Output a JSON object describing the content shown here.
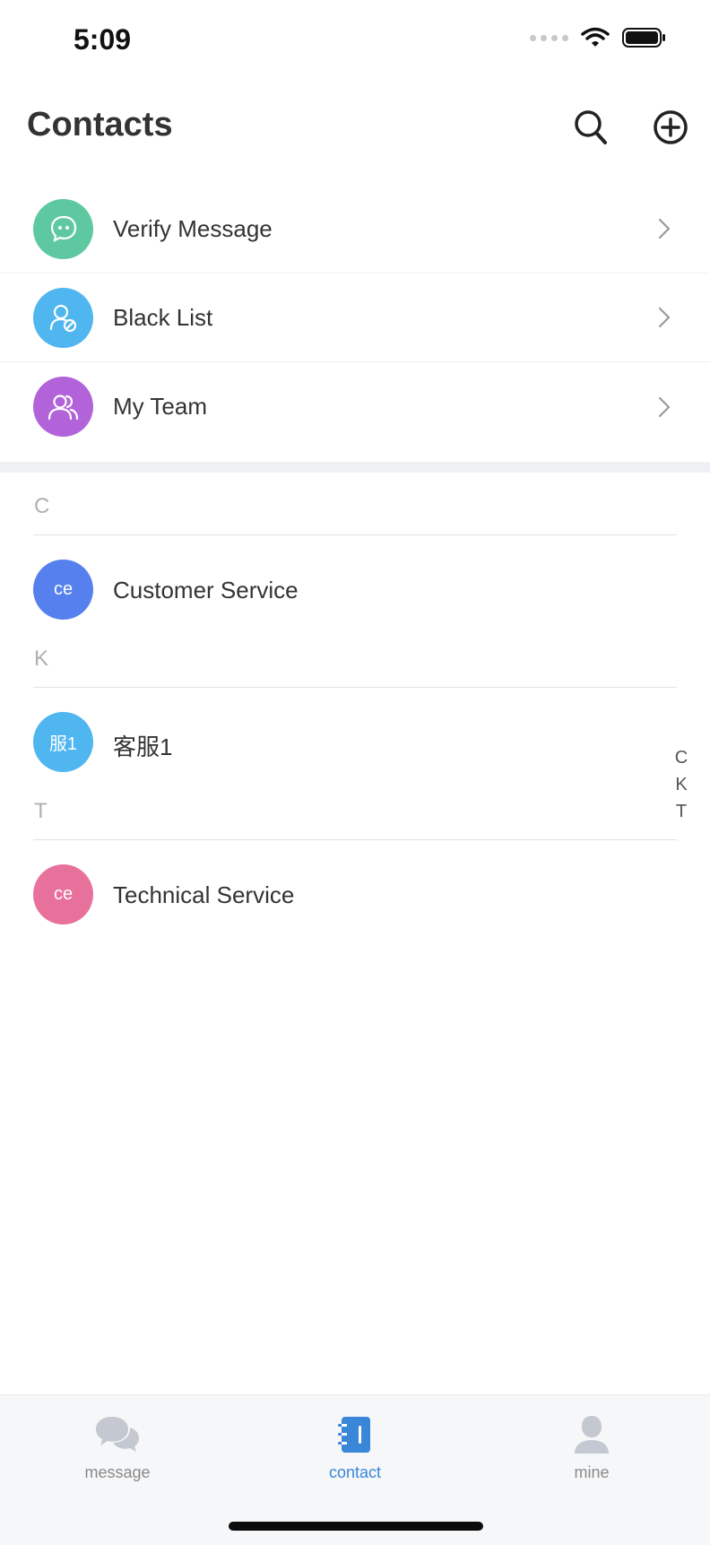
{
  "status_bar": {
    "time": "5:09"
  },
  "header": {
    "title": "Contacts"
  },
  "functions": [
    {
      "label": "Verify Message",
      "icon": "message-dots-icon",
      "color": "#5ec9a0"
    },
    {
      "label": "Black List",
      "icon": "blocked-user-icon",
      "color": "#4fb6f0"
    },
    {
      "label": "My Team",
      "icon": "team-icon",
      "color": "#b263d9"
    }
  ],
  "contact_groups": [
    {
      "letter": "C",
      "contacts": [
        {
          "avatar_text": "ce",
          "name": "Customer Service",
          "color": "#5580ee"
        }
      ]
    },
    {
      "letter": "K",
      "contacts": [
        {
          "avatar_text": "服1",
          "name": "客服1",
          "color": "#4fb6f0"
        }
      ]
    },
    {
      "letter": "T",
      "contacts": [
        {
          "avatar_text": "ce",
          "name": "Technical Service",
          "color": "#e8719b"
        }
      ]
    }
  ],
  "index_letters": [
    "C",
    "K",
    "T"
  ],
  "tabs": [
    {
      "label": "message",
      "icon": "chat-bubbles-icon",
      "active": false
    },
    {
      "label": "contact",
      "icon": "contact-book-icon",
      "active": true
    },
    {
      "label": "mine",
      "icon": "user-profile-icon",
      "active": false
    }
  ],
  "colors": {
    "accent": "#3a86d8",
    "inactive": "#c4c8d0"
  }
}
